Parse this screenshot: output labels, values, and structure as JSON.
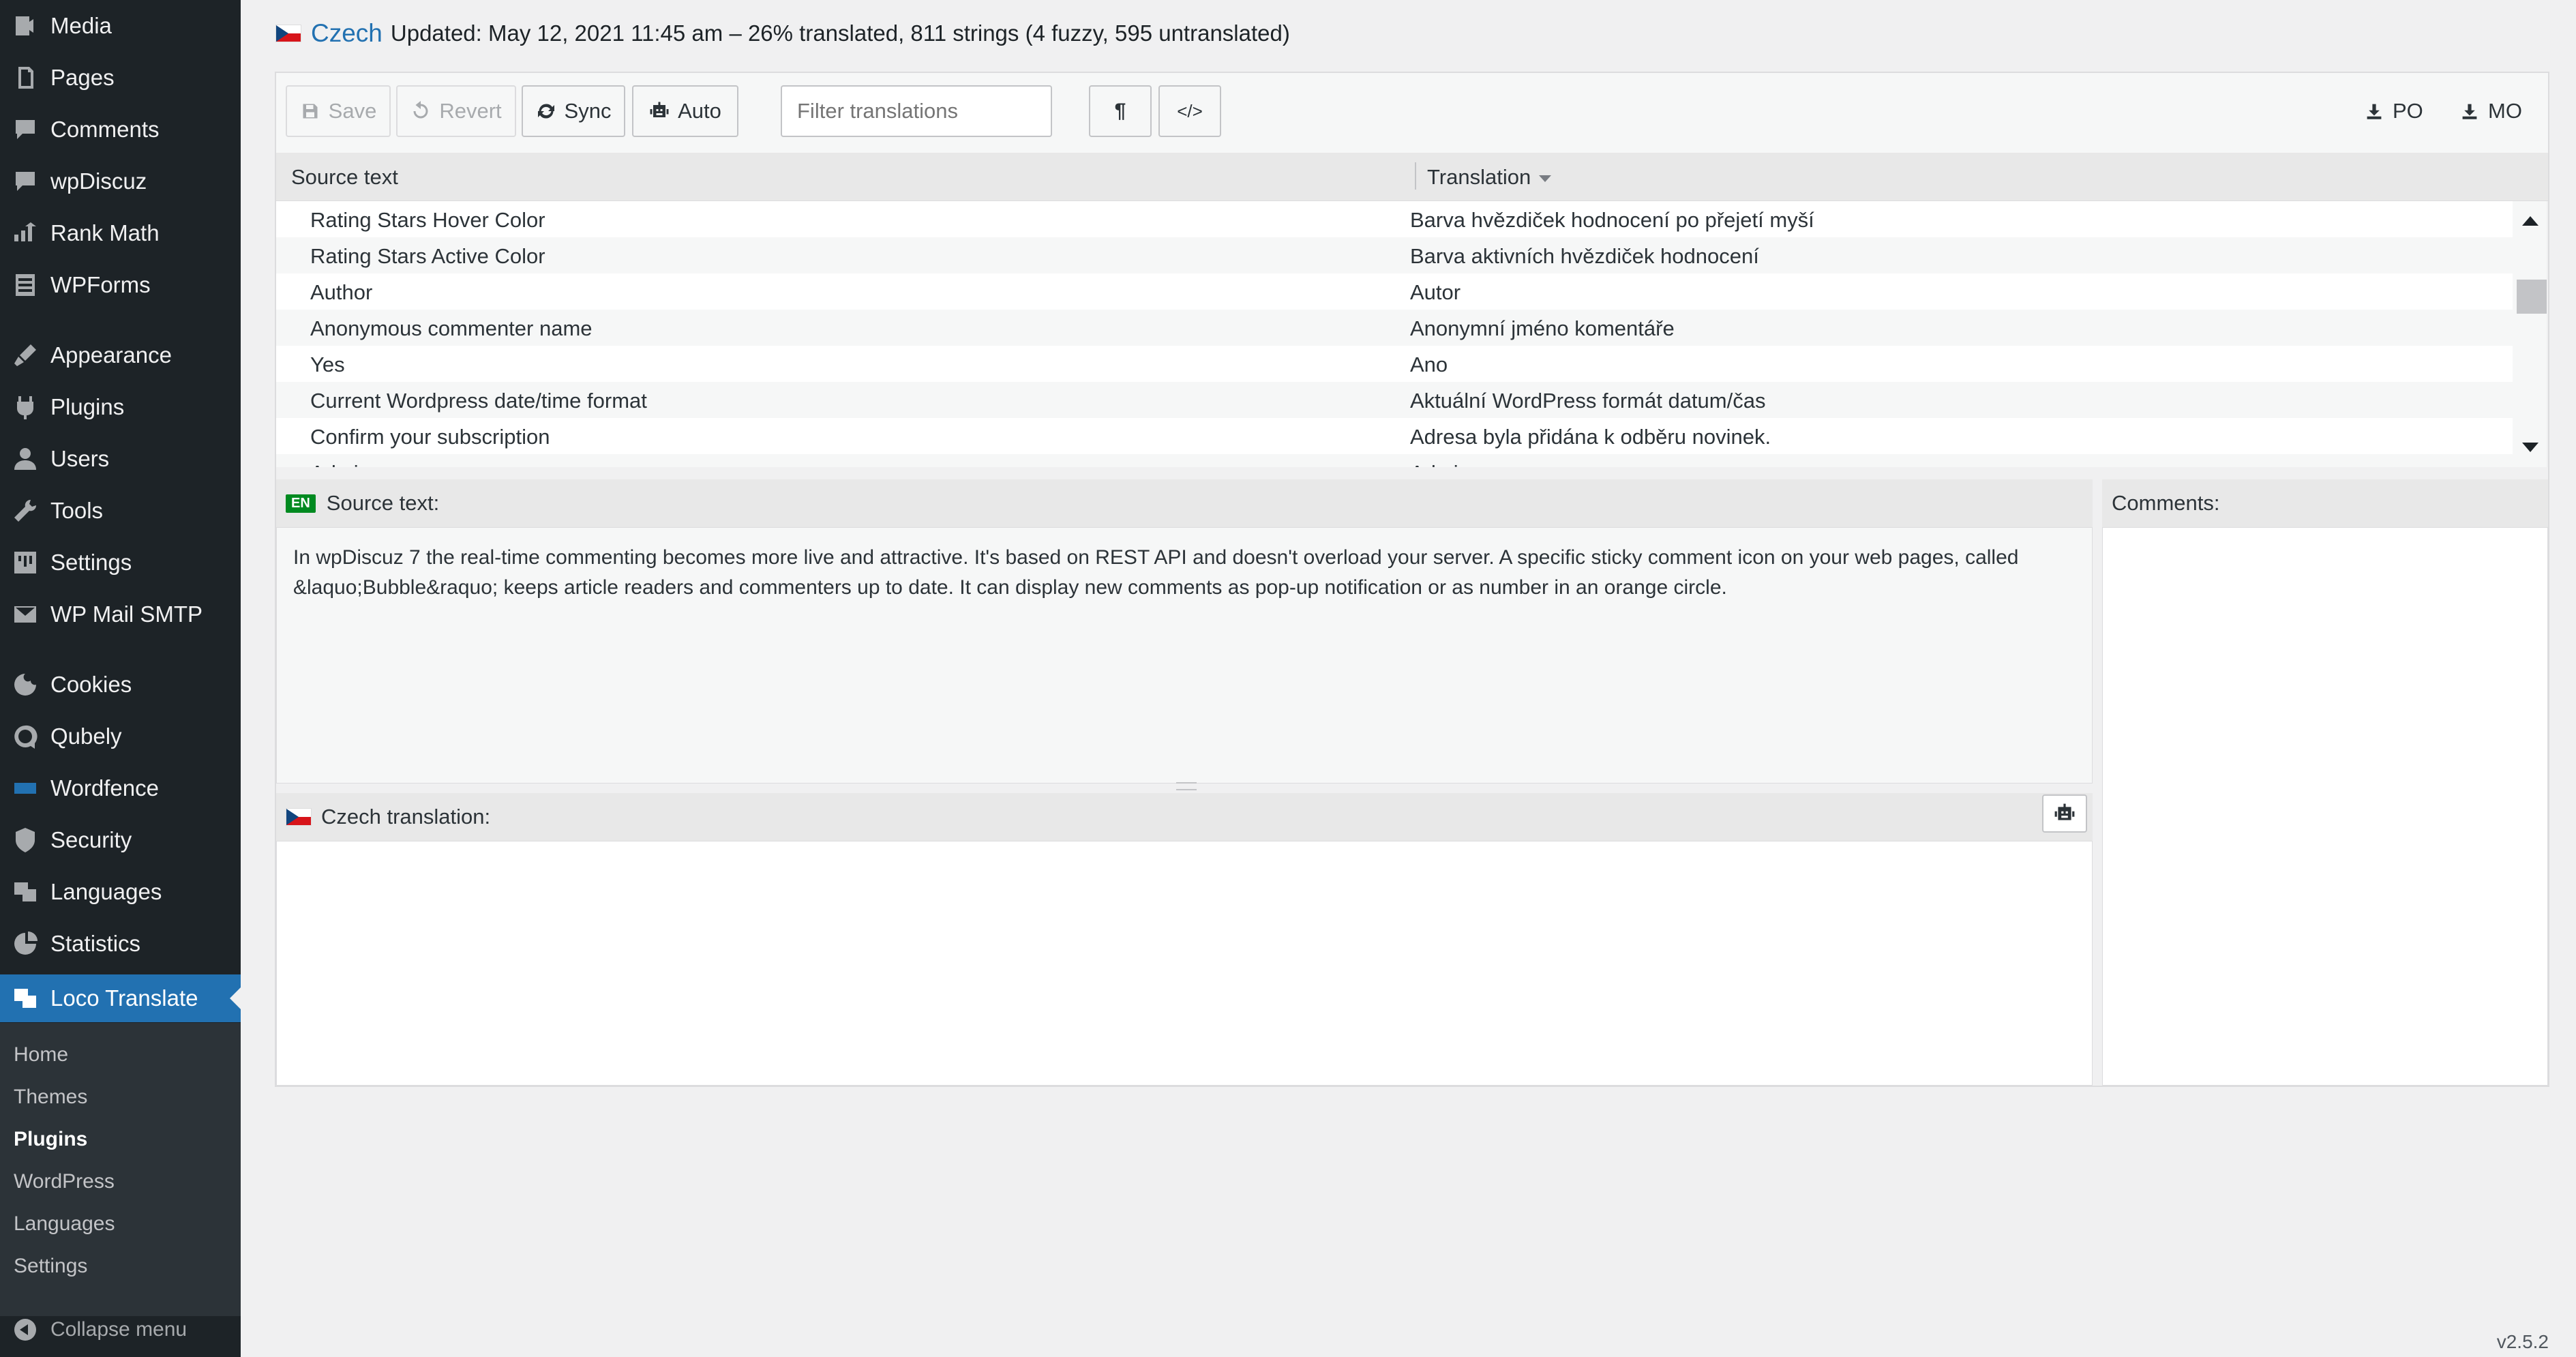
{
  "sidebar": {
    "items": [
      {
        "label": "Media",
        "icon": "media-icon"
      },
      {
        "label": "Pages",
        "icon": "pages-icon"
      },
      {
        "label": "Comments",
        "icon": "comments-icon"
      },
      {
        "label": "wpDiscuz",
        "icon": "wpdiscuz-icon"
      },
      {
        "label": "Rank Math",
        "icon": "rank-math-icon"
      },
      {
        "label": "WPForms",
        "icon": "wpforms-icon"
      },
      {
        "label": "Appearance",
        "icon": "appearance-icon"
      },
      {
        "label": "Plugins",
        "icon": "plugins-icon"
      },
      {
        "label": "Users",
        "icon": "users-icon"
      },
      {
        "label": "Tools",
        "icon": "tools-icon"
      },
      {
        "label": "Settings",
        "icon": "settings-icon"
      },
      {
        "label": "WP Mail SMTP",
        "icon": "mail-icon"
      },
      {
        "label": "Cookies",
        "icon": "cookies-icon"
      },
      {
        "label": "Qubely",
        "icon": "qubely-icon"
      },
      {
        "label": "Wordfence",
        "icon": "wordfence-icon"
      },
      {
        "label": "Security",
        "icon": "security-icon"
      },
      {
        "label": "Languages",
        "icon": "languages-icon"
      },
      {
        "label": "Statistics",
        "icon": "statistics-icon"
      },
      {
        "label": "Loco Translate",
        "icon": "loco-translate-icon"
      }
    ],
    "submenu": [
      "Home",
      "Themes",
      "Plugins",
      "WordPress",
      "Languages",
      "Settings"
    ],
    "collapse_label": "Collapse menu"
  },
  "header": {
    "language": "Czech",
    "status": "Updated: May 12, 2021 11:45 am – 26% translated, 811 strings (4 fuzzy, 595 untranslated)"
  },
  "toolbar": {
    "save": "Save",
    "revert": "Revert",
    "sync": "Sync",
    "auto": "Auto",
    "filter_placeholder": "Filter translations",
    "po": "PO",
    "mo": "MO"
  },
  "table": {
    "headers": {
      "source": "Source text",
      "translation": "Translation"
    },
    "rows": [
      {
        "source": "Rating Stars Hover Color",
        "translation": "Barva hvězdiček hodnocení po přejetí myší"
      },
      {
        "source": "Rating Stars Active Color",
        "translation": "Barva aktivních hvězdiček hodnocení"
      },
      {
        "source": "Author",
        "translation": "Autor"
      },
      {
        "source": "Anonymous commenter name",
        "translation": "Anonymní jméno komentáře"
      },
      {
        "source": "Yes",
        "translation": "Ano"
      },
      {
        "source": "Current Wordpress date/time format",
        "translation": "Aktuální WordPress formát datum/čas"
      },
      {
        "source": "Confirm your subscription",
        "translation": "Adresa byla přidána k odběru novinek."
      },
      {
        "source": "Admin",
        "translation": "Admin"
      }
    ]
  },
  "source_panel": {
    "badge": "EN",
    "title": "Source text:",
    "text": "In wpDiscuz 7 the real-time commenting becomes more live and attractive. It's based on REST API and doesn't overload your server. A specific sticky comment icon on your web pages, called &laquo;Bubble&raquo; keeps article readers and commenters up to date. It can display new comments as pop-up notification or as number in an orange circle."
  },
  "translation_panel": {
    "title": "Czech translation:"
  },
  "comments_panel": {
    "title": "Comments:"
  },
  "version": "v2.5.2",
  "colors": {
    "sidebar_bg": "#1d2327",
    "active_bg": "#2271b1",
    "link": "#2271b1",
    "en_badge": "#008a20"
  }
}
